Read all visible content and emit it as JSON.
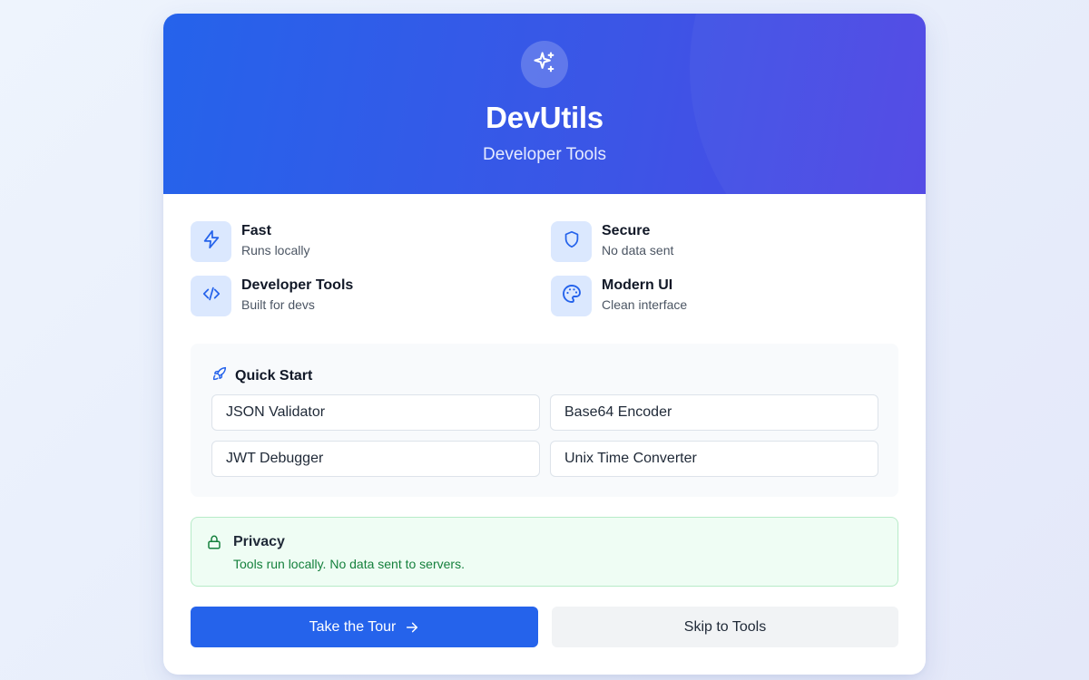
{
  "hero": {
    "title": "DevUtils",
    "subtitle": "Developer Tools",
    "icon": "sparkles-icon"
  },
  "features": [
    {
      "title": "Fast",
      "description": "Runs locally",
      "icon": "lightning-icon"
    },
    {
      "title": "Secure",
      "description": "No data sent",
      "icon": "shield-icon"
    },
    {
      "title": "Developer Tools",
      "description": "Built for devs",
      "icon": "code-icon"
    },
    {
      "title": "Modern UI",
      "description": "Clean interface",
      "icon": "palette-icon"
    }
  ],
  "quick_start": {
    "title": "Quick Start",
    "icon": "rocket-icon",
    "tools": [
      "JSON Validator",
      "Base64 Encoder",
      "JWT Debugger",
      "Unix Time Converter"
    ]
  },
  "privacy": {
    "title": "Privacy",
    "text": "Tools run locally. No data sent to servers.",
    "icon": "lock-icon"
  },
  "actions": {
    "primary_label": "Take the Tour",
    "primary_icon": "arrow-right-icon",
    "secondary_label": "Skip to Tools"
  },
  "colors": {
    "accent": "#2563eb",
    "hero_gradient_end": "#4f46e5",
    "feature_icon_bg": "#dbe8fe",
    "privacy_bg": "#effdf4",
    "privacy_text": "#15803d"
  }
}
